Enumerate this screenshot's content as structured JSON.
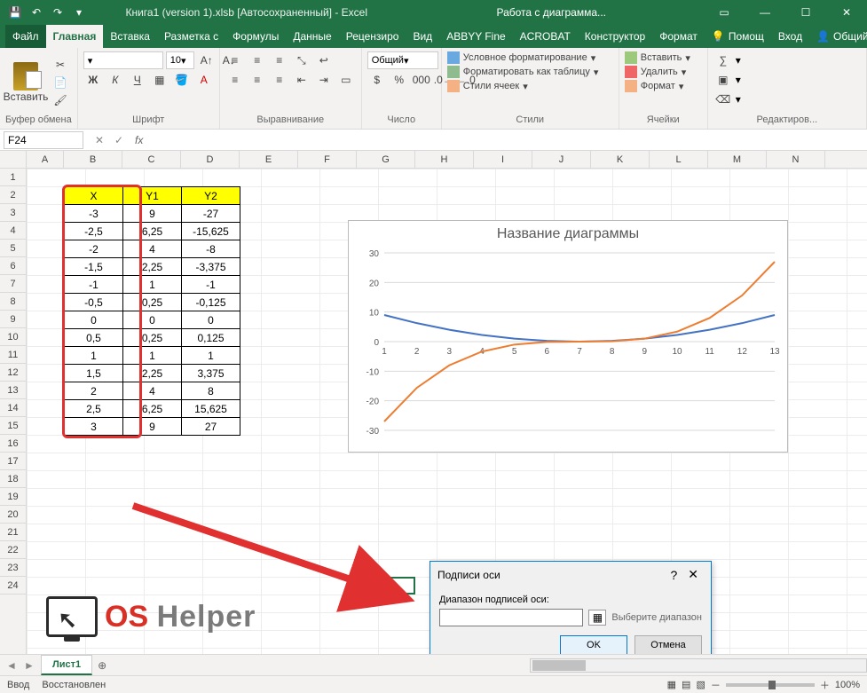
{
  "titlebar": {
    "doc_title": "Книга1 (version 1).xlsb [Автосохраненный] - Excel",
    "context_title": "Работа с диаграмма..."
  },
  "tabs": {
    "file": "Файл",
    "items": [
      "Главная",
      "Вставка",
      "Разметка с",
      "Формулы",
      "Данные",
      "Рецензиро",
      "Вид",
      "ABBYY Fine",
      "ACROBAT",
      "Конструктор",
      "Формат"
    ],
    "active_index": 0,
    "help": "Помощ",
    "signin": "Вход",
    "share": "Общий доступ"
  },
  "ribbon": {
    "clipboard": {
      "paste": "Вставить",
      "label": "Буфер обмена"
    },
    "font": {
      "label": "Шрифт",
      "size": "10",
      "bold": "Ж",
      "italic": "К",
      "underline": "Ч"
    },
    "align": {
      "label": "Выравнивание"
    },
    "number": {
      "label": "Число",
      "format": "Общий"
    },
    "styles": {
      "label": "Стили",
      "cond": "Условное форматирование",
      "table": "Форматировать как таблицу",
      "cell": "Стили ячеек"
    },
    "cells": {
      "label": "Ячейки",
      "insert": "Вставить",
      "delete": "Удалить",
      "format": "Формат"
    },
    "editing": {
      "label": "Редактиров..."
    }
  },
  "formulabar": {
    "namebox": "F24",
    "fx": "fx"
  },
  "columns": [
    "A",
    "B",
    "C",
    "D",
    "E",
    "F",
    "G",
    "H",
    "I",
    "J",
    "K",
    "L",
    "M",
    "N"
  ],
  "rows": [
    1,
    2,
    3,
    4,
    5,
    6,
    7,
    8,
    9,
    10,
    11,
    12,
    13,
    14,
    15,
    16,
    17,
    18,
    19,
    20,
    21,
    22,
    23,
    24
  ],
  "table": {
    "headers": [
      "X",
      "Y1",
      "Y2"
    ],
    "rows": [
      [
        "-3",
        "9",
        "-27"
      ],
      [
        "-2,5",
        "6,25",
        "-15,625"
      ],
      [
        "-2",
        "4",
        "-8"
      ],
      [
        "-1,5",
        "2,25",
        "-3,375"
      ],
      [
        "-1",
        "1",
        "-1"
      ],
      [
        "-0,5",
        "0,25",
        "-0,125"
      ],
      [
        "0",
        "0",
        "0"
      ],
      [
        "0,5",
        "0,25",
        "0,125"
      ],
      [
        "1",
        "1",
        "1"
      ],
      [
        "1,5",
        "2,25",
        "3,375"
      ],
      [
        "2",
        "4",
        "8"
      ],
      [
        "2,5",
        "6,25",
        "15,625"
      ],
      [
        "3",
        "9",
        "27"
      ]
    ]
  },
  "chart": {
    "title": "Название диаграммы"
  },
  "chart_data": {
    "type": "line",
    "title": "Название диаграммы",
    "xlabel": "",
    "ylabel": "",
    "categories": [
      1,
      2,
      3,
      4,
      5,
      6,
      7,
      8,
      9,
      10,
      11,
      12,
      13
    ],
    "ylim": [
      -30,
      30
    ],
    "yticks": [
      -30,
      -20,
      -10,
      0,
      10,
      20,
      30
    ],
    "series": [
      {
        "name": "Y1",
        "color": "#4472C4",
        "values": [
          9,
          6.25,
          4,
          2.25,
          1,
          0.25,
          0,
          0.25,
          1,
          2.25,
          4,
          6.25,
          9
        ]
      },
      {
        "name": "Y2",
        "color": "#ED7D31",
        "values": [
          -27,
          -15.625,
          -8,
          -3.375,
          -1,
          -0.125,
          0,
          0.125,
          1,
          3.375,
          8,
          15.625,
          27
        ]
      }
    ]
  },
  "dialog": {
    "title": "Подписи оси",
    "label": "Диапазон подписей оси:",
    "hint": "Выберите диапазон",
    "ok": "OK",
    "cancel": "Отмена",
    "input": ""
  },
  "sheet": {
    "name": "Лист1"
  },
  "status": {
    "mode": "Ввод",
    "recovered": "Восстановлен",
    "zoom": "100%"
  },
  "watermark": {
    "os": "OS",
    "helper": "Helper"
  }
}
